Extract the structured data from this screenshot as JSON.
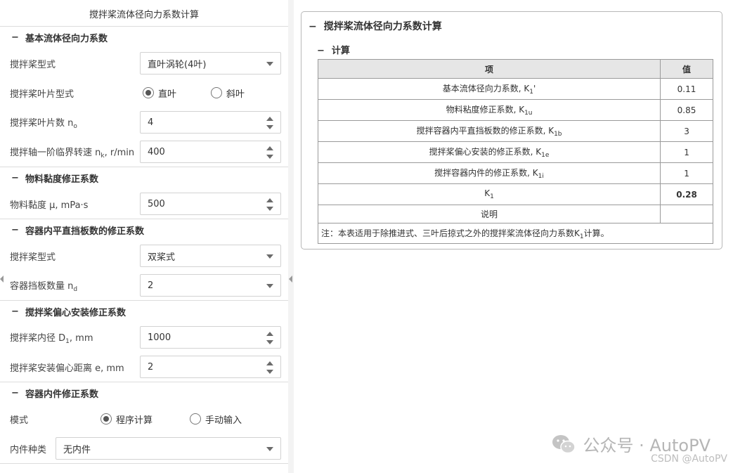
{
  "left_panel": {
    "title": "搅拌桨流体径向力系数计算",
    "sections": {
      "basic": {
        "title": "基本流体径向力系数",
        "impeller_type": {
          "label": "搅拌桨型式",
          "value": "直叶涡轮(4叶)"
        },
        "blade_type": {
          "label": "搅拌桨叶片型式",
          "option_a": "直叶",
          "option_b": "斜叶",
          "selected": "直叶"
        },
        "blade_count": {
          "label": "搅拌桨叶片数 n",
          "sub": "o",
          "value": "4"
        },
        "critical_speed": {
          "label": "搅拌轴一阶临界转速 n",
          "sub": "k",
          "unit": ", r/min",
          "value": "400"
        }
      },
      "viscosity": {
        "title": "物料黏度修正系数",
        "viscosity": {
          "label": "物料黏度 μ, mPa·s",
          "value": "500"
        }
      },
      "baffle": {
        "title": "容器内平直挡板数的修正系数",
        "impeller_form": {
          "label": "搅拌桨型式",
          "value": "双桨式"
        },
        "baffle_count": {
          "label": "容器挡板数量 n",
          "sub": "d",
          "value": "2"
        }
      },
      "eccentric": {
        "title": "搅拌桨偏心安装修正系数",
        "inner_diameter": {
          "label": "搅拌桨内径 D",
          "sub": "1",
          "unit": ", mm",
          "value": "1000"
        },
        "eccentric_distance": {
          "label": "搅拌桨安装偏心距离 e, mm",
          "value": "2"
        }
      },
      "internals": {
        "title": "容器内件修正系数",
        "mode": {
          "label": "模式",
          "option_a": "程序计算",
          "option_b": "手动输入",
          "selected": "程序计算"
        },
        "internal_type": {
          "label": "内件种类",
          "value": "无内件"
        }
      }
    }
  },
  "right_panel": {
    "card_title": "搅拌桨流体径向力系数计算",
    "sub_title": "计算",
    "table": {
      "header_item": "项",
      "header_value": "值",
      "rows": [
        {
          "label": "基本流体径向力系数, K",
          "sub": "1",
          "suffix": "'",
          "value": "0.11"
        },
        {
          "label": "物料粘度修正系数, K",
          "sub": "1u",
          "suffix": "",
          "value": "0.85"
        },
        {
          "label": "搅拌容器内平直挡板数的修正系数, K",
          "sub": "1b",
          "suffix": "",
          "value": "3"
        },
        {
          "label": "搅拌桨偏心安装的修正系数, K",
          "sub": "1e",
          "suffix": "",
          "value": "1"
        },
        {
          "label": "搅拌容器内件的修正系数, K",
          "sub": "1i",
          "suffix": "",
          "value": "1"
        },
        {
          "label": "K",
          "sub": "1",
          "suffix": "",
          "value": "0.28"
        }
      ],
      "desc_label": "说明",
      "desc_value": "",
      "note_prefix": "注：本表适用于除推进式、三叶后掠式之外的搅拌桨流体径向力系数K",
      "note_sub": "1",
      "note_suffix": "计算。"
    }
  },
  "watermark": {
    "line1": "公众号 · AutoPV",
    "line2": "CSDN @AutoPV"
  }
}
